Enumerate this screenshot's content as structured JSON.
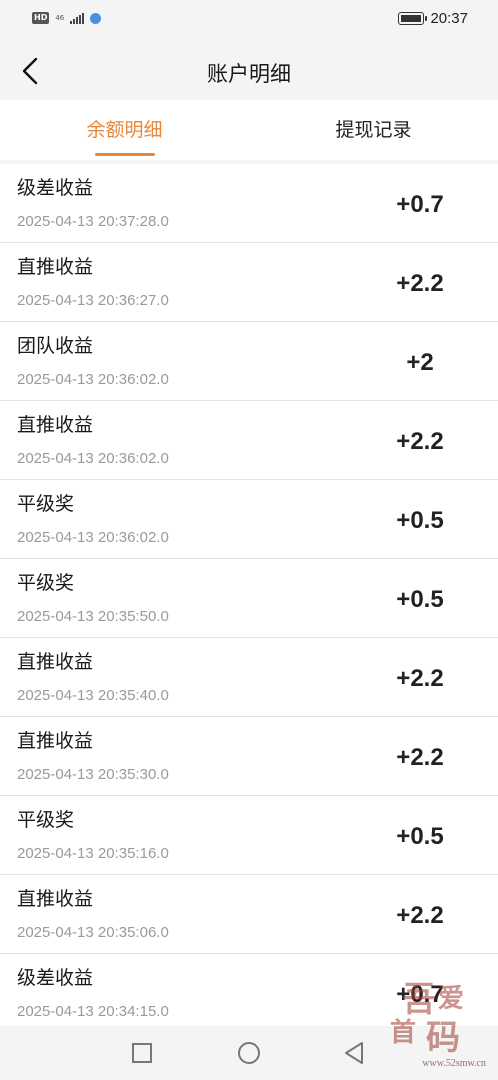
{
  "status_bar": {
    "hd": "HD",
    "network": [
      "46",
      "4G"
    ],
    "time": "20:37"
  },
  "header": {
    "title": "账户明细",
    "back_icon": "chevron-left-icon"
  },
  "tabs": [
    {
      "label": "余额明细",
      "active": true
    },
    {
      "label": "提现记录",
      "active": false
    }
  ],
  "records": [
    {
      "title": "级差收益",
      "time": "2025-04-13 20:37:28.0",
      "amount": "+0.7"
    },
    {
      "title": "直推收益",
      "time": "2025-04-13 20:36:27.0",
      "amount": "+2.2"
    },
    {
      "title": "团队收益",
      "time": "2025-04-13 20:36:02.0",
      "amount": "+2"
    },
    {
      "title": "直推收益",
      "time": "2025-04-13 20:36:02.0",
      "amount": "+2.2"
    },
    {
      "title": "平级奖",
      "time": "2025-04-13 20:36:02.0",
      "amount": "+0.5"
    },
    {
      "title": "平级奖",
      "time": "2025-04-13 20:35:50.0",
      "amount": "+0.5"
    },
    {
      "title": "直推收益",
      "time": "2025-04-13 20:35:40.0",
      "amount": "+2.2"
    },
    {
      "title": "直推收益",
      "time": "2025-04-13 20:35:30.0",
      "amount": "+2.2"
    },
    {
      "title": "平级奖",
      "time": "2025-04-13 20:35:16.0",
      "amount": "+0.5"
    },
    {
      "title": "直推收益",
      "time": "2025-04-13 20:35:06.0",
      "amount": "+2.2"
    },
    {
      "title": "级差收益",
      "time": "2025-04-13 20:34:15.0",
      "amount": "+0.7"
    }
  ],
  "nav": {
    "icons": [
      "square-icon",
      "circle-home-icon",
      "triangle-back-icon"
    ]
  },
  "watermark": {
    "chars": [
      "吾",
      "爱",
      "首",
      "码"
    ],
    "url": "www.52smw.cn"
  },
  "colors": {
    "accent": "#e8873a",
    "background": "#f4f4f4",
    "text": "#222222",
    "muted": "#9a9a9a"
  }
}
